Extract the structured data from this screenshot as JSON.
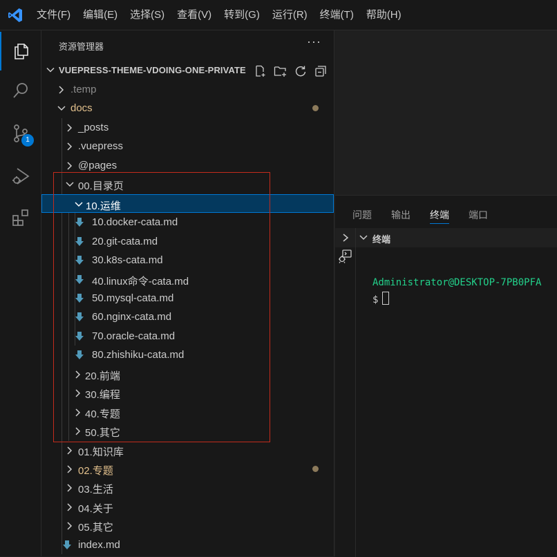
{
  "menu": [
    "文件(F)",
    "编辑(E)",
    "选择(S)",
    "查看(V)",
    "转到(G)",
    "运行(R)",
    "终端(T)",
    "帮助(H)"
  ],
  "activity_bar": {
    "icons": [
      "files-icon",
      "search-icon",
      "source-control-icon",
      "run-debug-icon",
      "extensions-icon"
    ],
    "source_control_badge": "1",
    "accent": "#0078d4"
  },
  "sidebar": {
    "title": "资源管理器",
    "more_label": "···",
    "workspace": "VUEPRESS-THEME-VDOING-ONE-PRIVATE",
    "workspace_actions": [
      "new-file-icon",
      "new-folder-icon",
      "refresh-icon",
      "collapse-all-icon"
    ],
    "tree": [
      {
        "label": ".temp",
        "type": "folder",
        "expanded": false,
        "depth": 0,
        "state": "dim"
      },
      {
        "label": "docs",
        "type": "folder",
        "expanded": true,
        "depth": 0,
        "state": "modified"
      },
      {
        "label": "_posts",
        "type": "folder",
        "expanded": false,
        "depth": 1,
        "state": "normal"
      },
      {
        "label": ".vuepress",
        "type": "folder",
        "expanded": false,
        "depth": 1,
        "state": "normal"
      },
      {
        "label": "@pages",
        "type": "folder",
        "expanded": false,
        "depth": 1,
        "state": "normal"
      },
      {
        "label": "00.目录页",
        "type": "folder",
        "expanded": true,
        "depth": 1,
        "state": "normal"
      },
      {
        "label": "10.运维",
        "type": "folder",
        "expanded": true,
        "depth": 2,
        "state": "selected"
      },
      {
        "label": "10.docker-cata.md",
        "type": "file",
        "depth": 3,
        "state": "normal"
      },
      {
        "label": "20.git-cata.md",
        "type": "file",
        "depth": 3,
        "state": "normal"
      },
      {
        "label": "30.k8s-cata.md",
        "type": "file",
        "depth": 3,
        "state": "normal"
      },
      {
        "label": "40.linux命令-cata.md",
        "type": "file",
        "depth": 3,
        "state": "normal"
      },
      {
        "label": "50.mysql-cata.md",
        "type": "file",
        "depth": 3,
        "state": "normal"
      },
      {
        "label": "60.nginx-cata.md",
        "type": "file",
        "depth": 3,
        "state": "normal"
      },
      {
        "label": "70.oracle-cata.md",
        "type": "file",
        "depth": 3,
        "state": "normal"
      },
      {
        "label": "80.zhishiku-cata.md",
        "type": "file",
        "depth": 3,
        "state": "normal"
      },
      {
        "label": "20.前端",
        "type": "folder",
        "expanded": false,
        "depth": 2,
        "state": "normal"
      },
      {
        "label": "30.编程",
        "type": "folder",
        "expanded": false,
        "depth": 2,
        "state": "normal"
      },
      {
        "label": "40.专题",
        "type": "folder",
        "expanded": false,
        "depth": 2,
        "state": "normal"
      },
      {
        "label": "50.其它",
        "type": "folder",
        "expanded": false,
        "depth": 2,
        "state": "normal"
      },
      {
        "label": "01.知识库",
        "type": "folder",
        "expanded": false,
        "depth": 1,
        "state": "normal"
      },
      {
        "label": "02.专题",
        "type": "folder",
        "expanded": false,
        "depth": 1,
        "state": "modified"
      },
      {
        "label": "03.生活",
        "type": "folder",
        "expanded": false,
        "depth": 1,
        "state": "normal"
      },
      {
        "label": "04.关于",
        "type": "folder",
        "expanded": false,
        "depth": 1,
        "state": "normal"
      },
      {
        "label": "05.其它",
        "type": "folder",
        "expanded": false,
        "depth": 1,
        "state": "normal"
      },
      {
        "label": "index.md",
        "type": "file",
        "depth": 1,
        "state": "normal"
      }
    ]
  },
  "panel": {
    "tabs": [
      "问题",
      "输出",
      "终端",
      "端口"
    ],
    "active_tab": "终端",
    "terminal_title": "终端",
    "prompt_user": "Administrator@DESKTOP-7PB0PFA",
    "prompt_symbol": "$",
    "prompt_color": "#23d18b"
  }
}
